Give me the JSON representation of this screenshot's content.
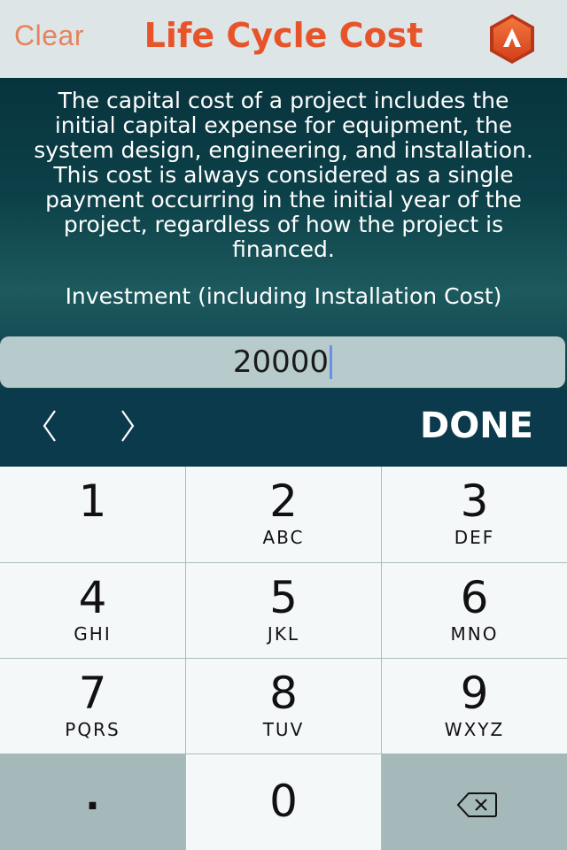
{
  "navbar": {
    "clear_label": "Clear",
    "title": "Life Cycle Cost",
    "logo_icon": "app-logo-icon",
    "accent_color": "#e8542a"
  },
  "content": {
    "description": "The capital cost of a project includes the initial capital expense for equipment, the system design, engineering, and installation. This cost is always considered as a single payment occurring in the initial year of the project, regardless of how the project is financed.",
    "field_label": "Investment (including Installation Cost)",
    "input_value": "20000"
  },
  "toolbar": {
    "prev_icon": "chevron-left-icon",
    "next_icon": "chevron-right-icon",
    "done_label": "DONE"
  },
  "keypad": {
    "keys": [
      {
        "num": "1",
        "letters": ""
      },
      {
        "num": "2",
        "letters": "ABC"
      },
      {
        "num": "3",
        "letters": "DEF"
      },
      {
        "num": "4",
        "letters": "GHI"
      },
      {
        "num": "5",
        "letters": "JKL"
      },
      {
        "num": "6",
        "letters": "MNO"
      },
      {
        "num": "7",
        "letters": "PQRS"
      },
      {
        "num": "8",
        "letters": "TUV"
      },
      {
        "num": "9",
        "letters": "WXYZ"
      }
    ],
    "decimal": ".",
    "zero": "0",
    "delete_icon": "backspace-icon"
  }
}
